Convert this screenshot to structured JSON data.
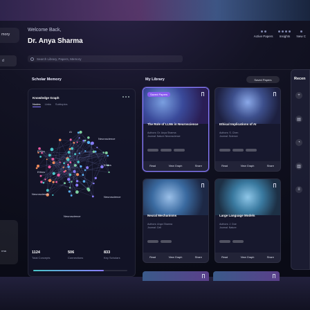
{
  "header": {
    "sidebar_label": "mory",
    "sidebar_sub": "d",
    "welcome": "Welcome Back,",
    "username": "Dr. Anya Sharma",
    "search_placeholder": "Search Library, Papers, Memory",
    "nav": [
      {
        "label": "Active Papers"
      },
      {
        "label": "Insights"
      },
      {
        "label": "New C"
      }
    ]
  },
  "scholar_memory": {
    "title": "Scholar Memory",
    "panel_title": "Knowledge Graph",
    "tabs": [
      "Nodes",
      "Links",
      "Subtopics"
    ],
    "nodes": [
      {
        "label": "AI"
      },
      {
        "label": "Neuroscience"
      },
      {
        "label": "Ethics"
      },
      {
        "label": "Ethics"
      },
      {
        "label": "Neuroscience"
      },
      {
        "label": "Neuroscience"
      },
      {
        "label": "Ethics"
      },
      {
        "label": "Neuroscience"
      }
    ],
    "stats": [
      {
        "value": "1124",
        "label": "Total Concepts"
      },
      {
        "value": "506",
        "label": "Connections"
      },
      {
        "value": "833",
        "label": "Key Scholars"
      }
    ],
    "progress": 0.75
  },
  "library": {
    "title": "My Library",
    "badge": "Saved Papers",
    "cards": [
      {
        "tag": "Saved Papers",
        "title": "The Role of LLMs in Neuroscience",
        "authors": "Authors: Dr. Anya Sharma",
        "journal": "Journal: Nature Neuroscience",
        "actions": [
          "Read",
          "View Graph",
          "Share"
        ]
      },
      {
        "tag": "",
        "title": "Ethical Implications of AI",
        "authors": "Authors: S. Chen",
        "journal": "Journal: Science",
        "actions": [
          "Read",
          "View Graph",
          "Share"
        ]
      },
      {
        "tag": "",
        "title": "Neural Mechanisms",
        "authors": "Authors: Anya Sharma",
        "journal": "Journal: Cell",
        "actions": [
          "Read",
          "View Graph",
          "Share"
        ]
      },
      {
        "tag": "",
        "title": "Large Language Models",
        "authors": "Authors: J. Doe",
        "journal": "Journal: Nature",
        "actions": [
          "Read",
          "View Graph",
          "Share"
        ]
      }
    ]
  },
  "recent": {
    "title": "Recen"
  },
  "leftcard": {
    "label": "rma"
  }
}
